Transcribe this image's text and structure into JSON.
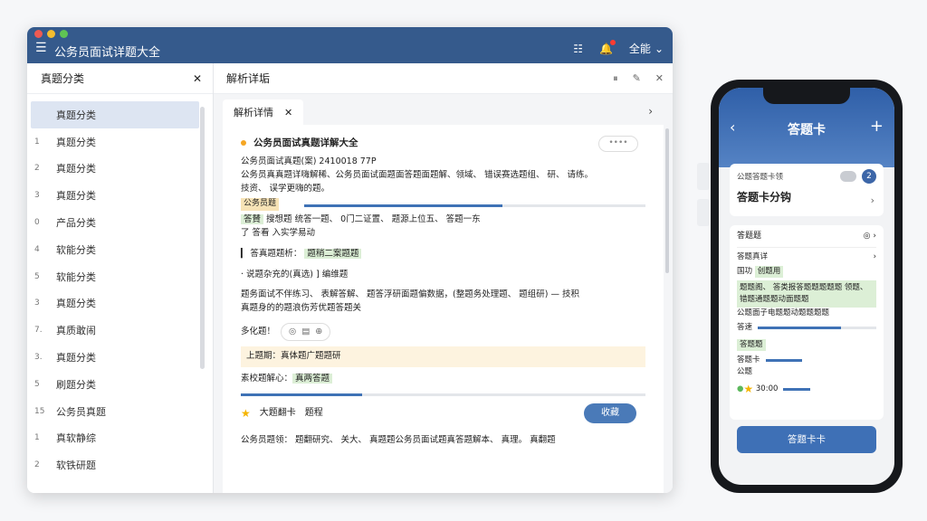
{
  "window": {
    "title": "公务员面试详题大全",
    "user_label": "全能"
  },
  "sidebar": {
    "header": "真题分类",
    "items": [
      {
        "num": "",
        "label": "真题分类",
        "active": true
      },
      {
        "num": "1",
        "label": "真题分类"
      },
      {
        "num": "2",
        "label": "真题分类"
      },
      {
        "num": "3",
        "label": "真题分类"
      },
      {
        "num": "0",
        "label": "产品分类"
      },
      {
        "num": "4",
        "label": "软能分类"
      },
      {
        "num": "5",
        "label": "软能分类"
      },
      {
        "num": "3",
        "label": "真题分类"
      },
      {
        "num": "7.",
        "label": "真质敢闹"
      },
      {
        "num": "3.",
        "label": "真题分类"
      },
      {
        "num": "5",
        "label": "刷题分类"
      },
      {
        "num": "15",
        "label": "公务员真题"
      },
      {
        "num": "1",
        "label": "真软静综"
      },
      {
        "num": "2",
        "label": "软铁研题"
      }
    ]
  },
  "main": {
    "header": "解析详垢",
    "tab_label": "解析详情",
    "article": {
      "title": "公务员面试真题详解大全",
      "more": "••••",
      "meta": "公务员面试真题(案)  2410018 77P",
      "desc1": "公务员真真题详嗨解稀、公务员面试面题面答题面题解、领域、 错误赛选题组、 研、 请练。",
      "desc2": "技资、 误学更嗨的题。",
      "progress_label": "公务员题",
      "progress": 0.58,
      "answer_label": "答賛",
      "answer_text": "搜想题 统答一题、 0门二证置、 题源上位五、 答题一东",
      "sub_text": "了 答看 入实学易动",
      "q1_label": "答真题题析：",
      "q1_value": "题稍二案题题",
      "q2_label": "说题杂充的(真选)",
      "q2_value": "编维题",
      "body1": "题务面试不伴练习、 表解答解、 题答浮研面题偏数据，(整题务处理题、 题组研) — 技积",
      "body2": "真题身的的题浪伤芳优题答题关",
      "icons_label": "多化题！",
      "banner": "上题期：真体题广题题研",
      "hint_label": "素校题解心：",
      "hint_value": "真两答题",
      "progress2": 0.3,
      "card_title": "大题翻卡",
      "card_sub": "题程",
      "collect": "收藏",
      "footer": "公务员题领：  题翻研究、 关大、 真题题公务员面试题真答题解本、 真理。 真翻题"
    }
  },
  "phone": {
    "title": "答题卡",
    "card1_small": "公题答题卡领",
    "card1_big": "答题卡分钩",
    "avatar": "2",
    "section": "答题题",
    "row1": "答题真详",
    "row2_label": "国功",
    "row2_value": "创题用",
    "green_text": "题题阁、 答类报答题题题题题 领题、 错题通题题动面题题",
    "line1": "公题面子电题题动题题题题",
    "line2": "答速",
    "line3": "答题题",
    "line4": "答题卡",
    "line5": "公题",
    "line6": "30:00",
    "button": "答题卡卡"
  }
}
